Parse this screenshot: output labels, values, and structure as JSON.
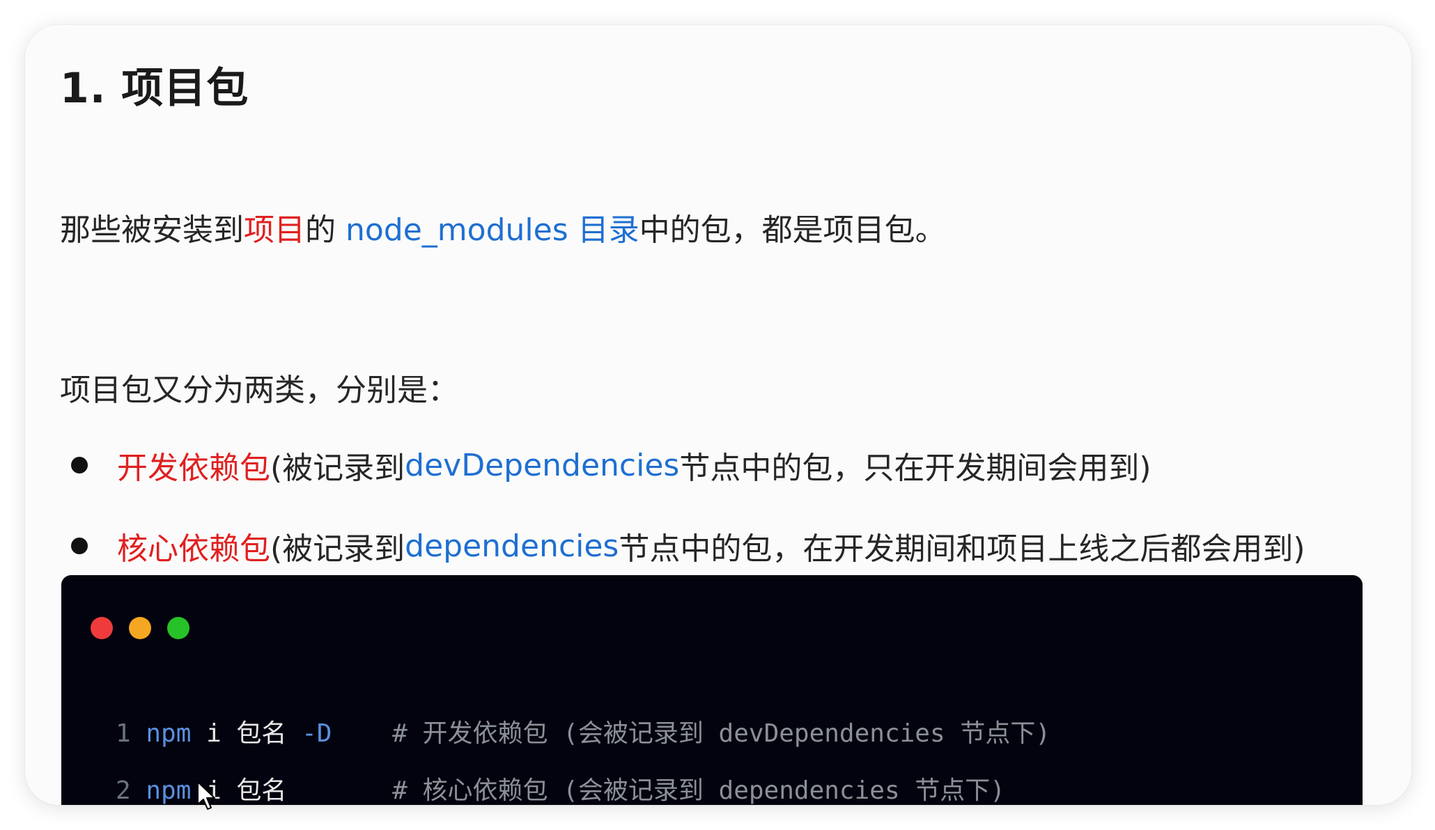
{
  "title": "1. 项目包",
  "intro": {
    "part1": "那些被安装到",
    "part2": "项目",
    "part3": "的 ",
    "part4": "node_modules 目录",
    "part5": "中的包，都是项目包。"
  },
  "categories_intro": "项目包又分为两类，分别是：",
  "bullets": [
    {
      "name": "开发依赖包",
      "pre": " (被记录到 ",
      "key": "devDependencies",
      "post": " 节点中的包，只在开发期间会用到)"
    },
    {
      "name": "核心依赖包",
      "pre": " (被记录到 ",
      "key": "dependencies",
      "post": " 节点中的包，在开发期间和项目上线之后都会用到)"
    }
  ],
  "code": {
    "lines": [
      {
        "num": "1",
        "npm": "npm",
        "cmd": " i 包名",
        "flag": " -D",
        "pad": "    ",
        "comment": "# 开发依赖包 (会被记录到 devDependencies 节点下)"
      },
      {
        "num": "2",
        "npm": "npm",
        "cmd": " i 包名",
        "flag": "",
        "pad": "       ",
        "comment": "# 核心依赖包 (会被记录到 dependencies 节点下)"
      }
    ]
  },
  "colors": {
    "highlight_red": "#e02020",
    "highlight_blue": "#1f6fd1",
    "terminal_bg": "#02030e"
  },
  "icons": {
    "window_controls": [
      "close-dot-icon",
      "minimize-dot-icon",
      "maximize-dot-icon"
    ],
    "cursor": "mouse-pointer-icon"
  }
}
